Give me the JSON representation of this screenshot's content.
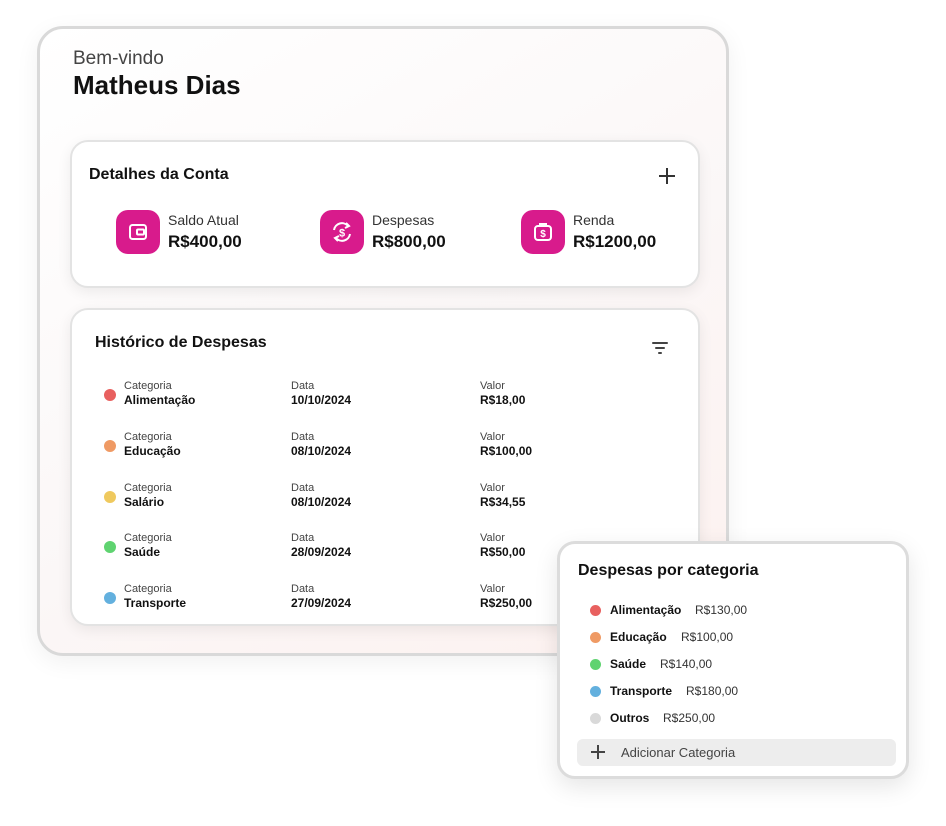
{
  "greeting": {
    "welcome": "Bem-vindo",
    "name": "Matheus Dias"
  },
  "account": {
    "title": "Detalhes da Conta",
    "metrics": [
      {
        "label": "Saldo Atual",
        "value": "R$400,00",
        "icon": "wallet-icon"
      },
      {
        "label": "Despesas",
        "value": "R$800,00",
        "icon": "currency-exchange-icon"
      },
      {
        "label": "Renda",
        "value": "R$1200,00",
        "icon": "money-bag-icon"
      }
    ],
    "accent_color": "#d81b8c"
  },
  "history": {
    "title": "Histórico de Despesas",
    "column_labels": {
      "category": "Categoria",
      "date": "Data",
      "value": "Valor"
    },
    "rows": [
      {
        "category": "Alimentação",
        "date": "10/10/2024",
        "value": "R$18,00",
        "color": "#e8605f"
      },
      {
        "category": "Educação",
        "date": "08/10/2024",
        "value": "R$100,00",
        "color": "#ef9a64"
      },
      {
        "category": "Salário",
        "date": "08/10/2024",
        "value": "R$34,55",
        "color": "#efc95e"
      },
      {
        "category": "Saúde",
        "date": "28/09/2024",
        "value": "R$50,00",
        "color": "#5fd370"
      },
      {
        "category": "Transporte",
        "date": "27/09/2024",
        "value": "R$250,00",
        "color": "#63b0de"
      }
    ]
  },
  "categories": {
    "title": "Despesas por categoria",
    "items": [
      {
        "name": "Alimentação",
        "value": "R$130,00",
        "color": "#e8605f"
      },
      {
        "name": "Educação",
        "value": "R$100,00",
        "color": "#ef9a64"
      },
      {
        "name": "Saúde",
        "value": "R$140,00",
        "color": "#5fd370"
      },
      {
        "name": "Transporte",
        "value": "R$180,00",
        "color": "#63b0de"
      },
      {
        "name": "Outros",
        "value": "R$250,00",
        "color": "#d9d9d9"
      }
    ],
    "add_label": "Adicionar Categoria"
  }
}
